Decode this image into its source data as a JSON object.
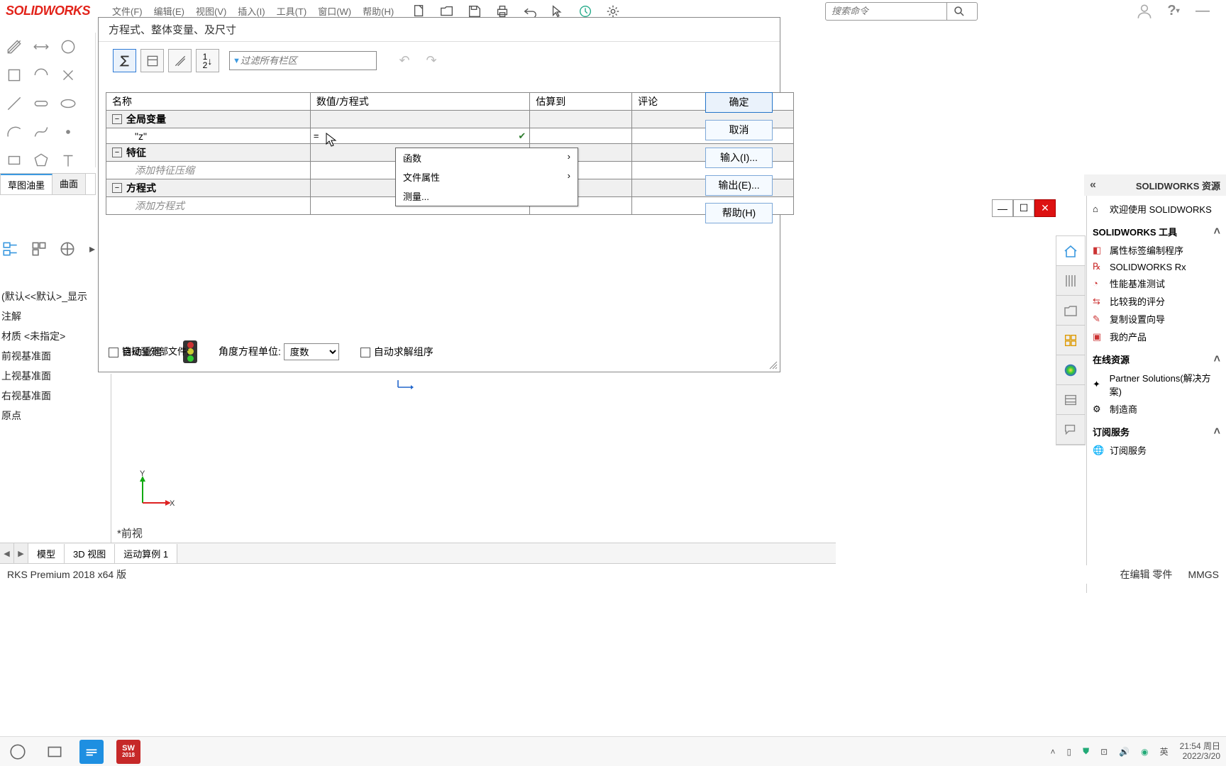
{
  "app": {
    "logo": "SOLIDWORKS"
  },
  "menubar": [
    "文件(F)",
    "编辑(E)",
    "视图(V)",
    "插入(I)",
    "工具(T)",
    "窗口(W)",
    "帮助(H)"
  ],
  "search_placeholder": "搜索命令",
  "sketch_tabs": {
    "active": "草图油墨",
    "second": "曲面"
  },
  "tree": {
    "root": "(默认<<默认>_显示",
    "items": [
      "注解",
      "材质 <未指定>",
      "前视基准面",
      "上视基准面",
      "右视基准面",
      "原点"
    ]
  },
  "dialog": {
    "title": "方程式、整体变量、及尺寸",
    "filter_placeholder": "过滤所有栏区",
    "columns": {
      "name": "名称",
      "value": "数值/方程式",
      "eval": "估算到",
      "comment": "评论"
    },
    "groups": {
      "global": "全局变量",
      "global_var_name": "\"z\"",
      "global_var_value": "=",
      "features": "特征",
      "features_ph": "添加特征压缩",
      "equations": "方程式",
      "equations_ph": "添加方程式"
    },
    "popup": {
      "func": "函数",
      "fileprops": "文件属性",
      "measure": "测量..."
    },
    "buttons": {
      "ok": "确定",
      "cancel": "取消",
      "import": "输入(I)...",
      "export": "输出(E)...",
      "help": "帮助(H)"
    },
    "bottom": {
      "auto_rebuild": "自动重建",
      "link_external": "链接至外部文件:",
      "angle_label": "角度方程单位:",
      "angle_value": "度数",
      "auto_solve": "自动求解组序"
    }
  },
  "rp_header": "SOLIDWORKS 资源",
  "rp": {
    "welcome": "欢迎使用  SOLIDWORKS",
    "section_tools": "SOLIDWORKS 工具",
    "tools": [
      "属性标签编制程序",
      "SOLIDWORKS Rx",
      "性能基准测试",
      "比较我的评分",
      "复制设置向导",
      "我的产品"
    ],
    "section_online": "在线资源",
    "online": [
      "Partner Solutions(解决方案)",
      "制造商"
    ],
    "section_sub": "订阅服务",
    "sub": [
      "订阅服务"
    ]
  },
  "viewport": {
    "label": "*前视"
  },
  "model_tabs": [
    "模型",
    "3D 视图",
    "运动算例 1"
  ],
  "status": {
    "left": "RKS Premium 2018 x64 版",
    "editing": "在编辑 零件",
    "units": "MMGS"
  },
  "taskbar": {
    "ime": "英",
    "time": "21:54 周日",
    "date": "2022/3/20"
  }
}
